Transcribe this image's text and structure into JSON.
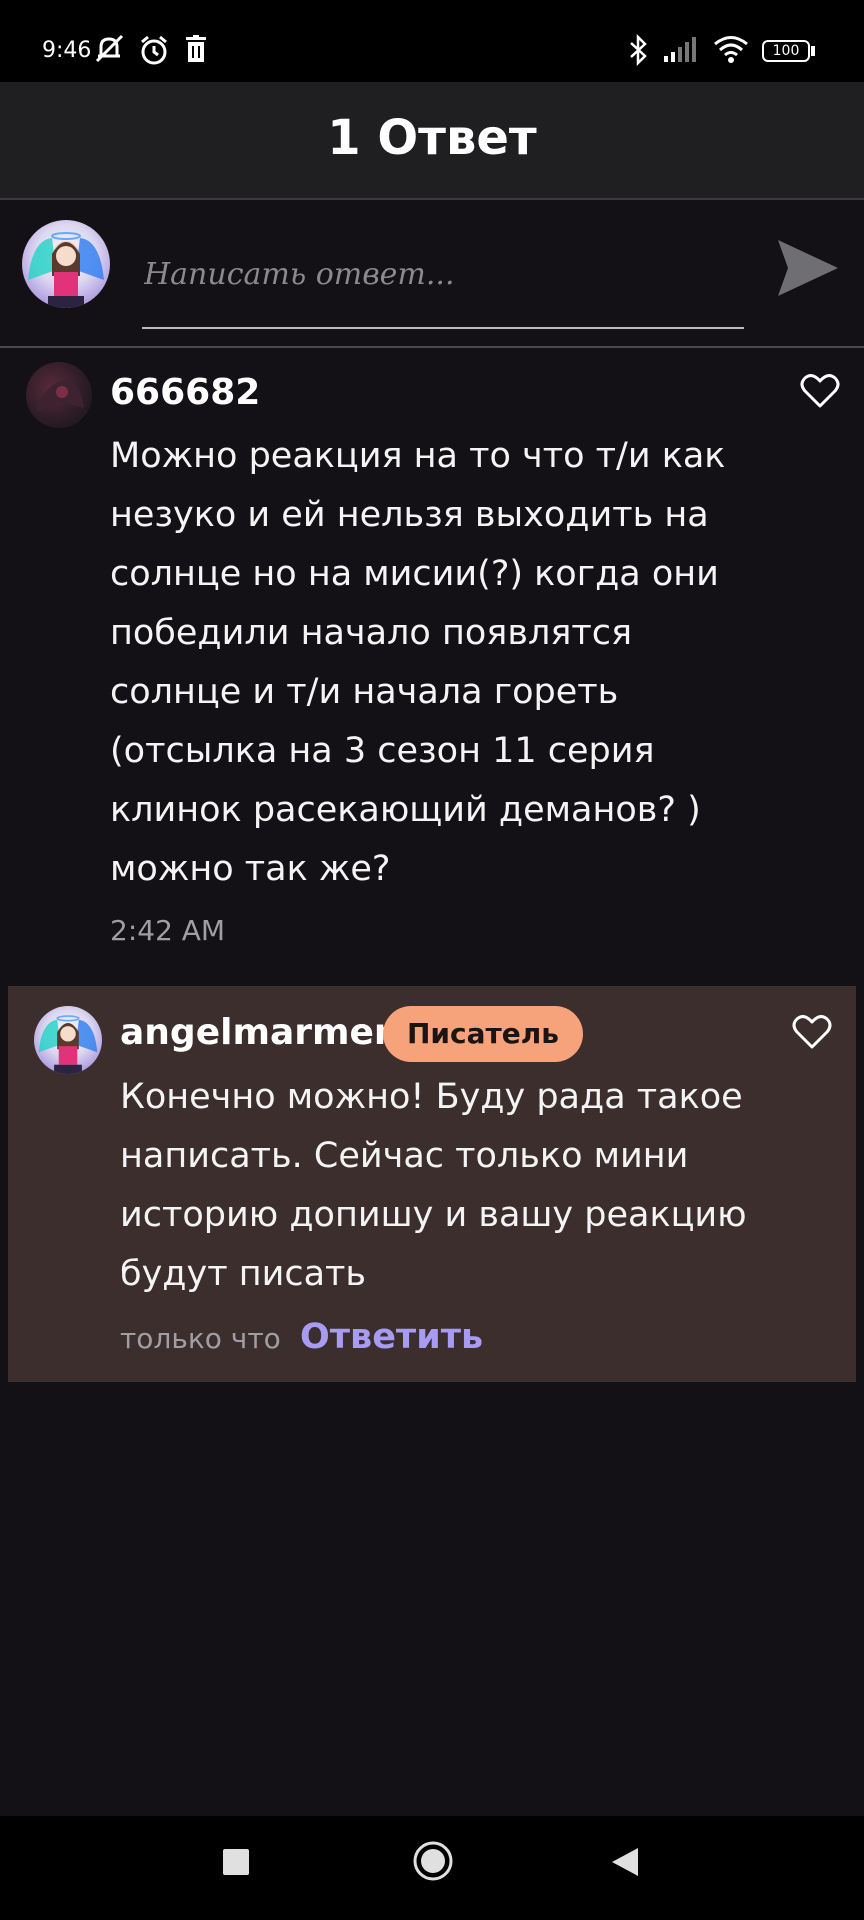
{
  "status_bar": {
    "time": "9:46",
    "icons": [
      "muted-bell-icon",
      "alarm-icon",
      "trash-icon",
      "bluetooth-icon",
      "signal-icon",
      "wifi-icon",
      "battery-icon"
    ],
    "battery": "100"
  },
  "header": {
    "title": "1 Ответ"
  },
  "compose": {
    "placeholder": "Написать ответ...",
    "send_icon": "send-icon"
  },
  "comment": {
    "author": "666682",
    "text_lines": [
      "Можно реакция на то что т/и как",
      "незуко и ей нельзя выходить на",
      "солнце но на мисии(?) когда они",
      "победили начало появлятся",
      "солнце и т/и начала гореть",
      "(отсылка на 3 сезон 11 серия",
      "клинок расекающий деманов? )",
      "можно так же?"
    ],
    "time": "2:42 AM"
  },
  "reply": {
    "author": "angelmarmer",
    "badge": "Писатель",
    "text_lines": [
      "Конечно можно! Буду рада такое",
      "написать. Сейчас только мини",
      "историю допишу и вашу реакцию",
      "будут писать"
    ],
    "time": "только что",
    "reply_label": "Ответить"
  },
  "colors": {
    "background": "#131115",
    "header": "#1f1e20",
    "reply_card": "#3b2e2d",
    "badge": "#f6a27a",
    "reply_link": "#a89bf2"
  },
  "nav": {
    "icons": [
      "square-recents-icon",
      "circle-home-icon",
      "triangle-back-icon"
    ]
  }
}
